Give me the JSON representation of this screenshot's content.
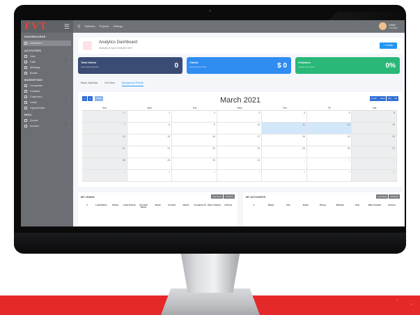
{
  "sidebar": {
    "brand": "FVT",
    "sections": [
      {
        "title": "DASHBOARDS",
        "items": [
          {
            "label": "Dashboard",
            "active": true
          }
        ]
      },
      {
        "title": "ACTIVITIES",
        "items": [
          {
            "label": "Jobs"
          },
          {
            "label": "Calls"
          },
          {
            "label": "Meetings"
          },
          {
            "label": "Emails"
          }
        ]
      },
      {
        "title": "MARKETING",
        "items": [
          {
            "label": "Companies"
          },
          {
            "label": "Contacts"
          },
          {
            "label": "Customers"
          },
          {
            "label": "Leads"
          },
          {
            "label": "Opportunities"
          }
        ]
      },
      {
        "title": "MISC",
        "items": [
          {
            "label": "Quotes"
          },
          {
            "label": "Invoices"
          }
        ]
      }
    ]
  },
  "topbar": {
    "items": [
      "Statistics",
      "Projects",
      "Settings"
    ],
    "user_name": "natalia",
    "user_role": "manager"
  },
  "header": {
    "title": "Analytics Dashboard",
    "subtitle": "Analysis all your Analytics here",
    "create_label": "+ Create"
  },
  "cards": [
    {
      "title": "Total Orders",
      "sub": "Last year expenses",
      "value": "0",
      "color": "#3a4b74"
    },
    {
      "title": "Clients",
      "sub": "Total Clients Profit",
      "value": "$ 0",
      "color": "#2f8cf0"
    },
    {
      "title": "Followers",
      "sub": "People Interested",
      "value": "0%",
      "color": "#29b878"
    }
  ],
  "tabs": [
    "Basic Calendar",
    "List View",
    "Background Events"
  ],
  "calendar": {
    "title": "March 2021",
    "today": "today",
    "prev": "<",
    "next": ">",
    "views": [
      "month",
      "week",
      "day",
      "list"
    ],
    "dow": [
      "Sun",
      "Mon",
      "Tue",
      "Wed",
      "Thu",
      "Fri",
      "Sat"
    ],
    "weeks": [
      [
        "28",
        "1",
        "2",
        "3",
        "4",
        "5",
        "6"
      ],
      [
        "7",
        "8",
        "9",
        "10",
        "11",
        "12",
        "13"
      ],
      [
        "14",
        "15",
        "16",
        "17",
        "18",
        "19",
        "20"
      ],
      [
        "21",
        "22",
        "23",
        "24",
        "25",
        "26",
        "27"
      ],
      [
        "28",
        "29",
        "30",
        "31",
        "1",
        "2",
        "3"
      ],
      [
        "4",
        "5",
        "6",
        "7",
        "8",
        "9",
        "10"
      ]
    ]
  },
  "leads": {
    "title": "MY LEADS",
    "buttons": [
      "Last Week",
      "All Month"
    ],
    "columns": [
      "#",
      "Lead Name",
      "Status",
      "Lead Source",
      "Account Name",
      "Email",
      "Contact",
      "Owner",
      "Assigned To",
      "Date Created",
      "Actions"
    ]
  },
  "accounts": {
    "title": "MY ACCOUNTS",
    "buttons": [
      "Last Week",
      "All Month"
    ],
    "columns": [
      "#",
      "Name",
      "City",
      "Email",
      "Phone",
      "Website",
      "User",
      "Date Created",
      "Actions"
    ]
  }
}
